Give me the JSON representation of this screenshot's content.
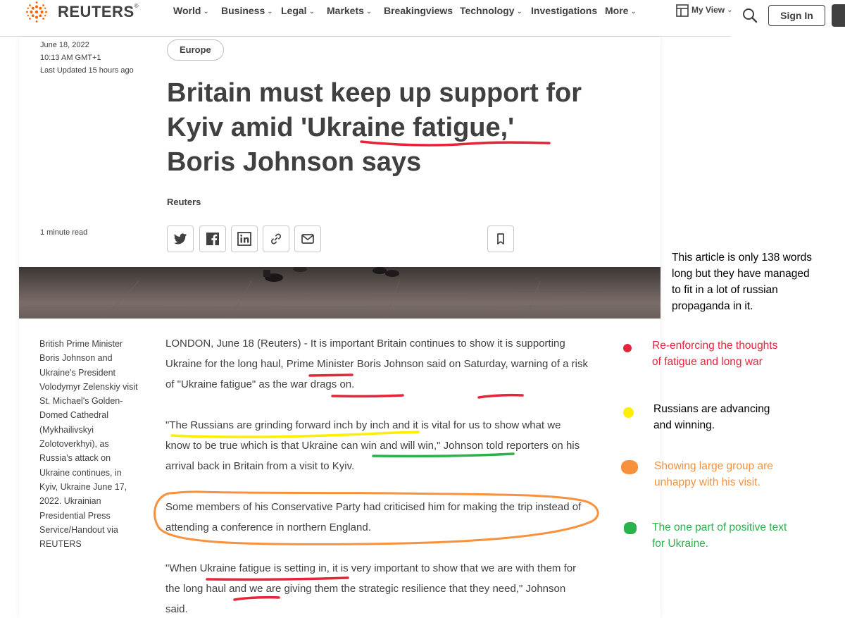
{
  "header": {
    "logo_text": "REUTERS",
    "logo_mark": "®",
    "nav_items": [
      {
        "label": "World",
        "has_dropdown": true
      },
      {
        "label": "Business",
        "has_dropdown": true
      },
      {
        "label": "Legal",
        "has_dropdown": true
      },
      {
        "label": "Markets",
        "has_dropdown": true
      },
      {
        "label": "Breakingviews",
        "has_dropdown": false
      },
      {
        "label": "Technology",
        "has_dropdown": true
      },
      {
        "label": "Investigations",
        "has_dropdown": false
      },
      {
        "label": "More",
        "has_dropdown": true
      }
    ],
    "my_view_label": "My View",
    "sign_in_label": "Sign In",
    "icons": {
      "my_view": "layout-icon",
      "search": "search-icon",
      "account": "account-icon"
    }
  },
  "article": {
    "date": "June 18, 2022",
    "time": "10:13 AM GMT+1",
    "last_updated": "Last Updated 15 hours ago",
    "section_tag": "Europe",
    "headline": "Britain must keep up support for Kyiv amid 'Ukraine fatigue,' Boris Johnson says",
    "byline": "Reuters",
    "read_time": "1 minute read",
    "share_icons": [
      "twitter-icon",
      "facebook-icon",
      "linkedin-icon",
      "link-icon",
      "email-icon"
    ],
    "bookmark_icon": "bookmark-icon",
    "photo_caption": "British Prime Minister Boris Johnson and Ukraine's President Volodymyr Zelenskiy visit St. Michael's Golden-Domed Cathedral (Mykhailivskyi Zolotoverkhyi), as Russia's attack on Ukraine continues, in Kyiv, Ukraine June 17, 2022. Ukrainian Presidential Press Service/Handout via REUTERS",
    "paragraphs": [
      "LONDON, June 18 (Reuters) - It is important Britain continues to show it is supporting Ukraine for the long haul, Prime Minister Boris Johnson said on Saturday, warning of a risk of \"Ukraine fatigue\" as the war drags on.",
      "\"The Russians are grinding forward inch by inch and it is vital for us to show what we know to be true which is that Ukraine can win and will win,\" Johnson told reporters on his arrival back in Britain from a visit to Kyiv.",
      "Some members of his Conservative Party had criticised him for making the trip instead of attending a conference in northern England.",
      "\"When Ukraine fatigue is setting in, it is very important to show that we are with them for the long haul and we are giving them the strategic resilience that they need,\" Johnson said."
    ]
  },
  "annotations": {
    "summary": "This article is only 138 words long but they have managed to fit in a lot of russian propaganda in it.",
    "legend": [
      {
        "color": "#e8243a",
        "text": "Re-enforcing the thoughts of fatigue and long war"
      },
      {
        "color": "#ffee00",
        "text": "Russians are advancing and winning."
      },
      {
        "color": "#f7913c",
        "text": "Showing large group are unhappy with his visit."
      },
      {
        "color": "#2ab34a",
        "text": "The one part of positive text for Ukraine."
      }
    ],
    "legend_text_colors": [
      "#e8243a",
      "#000000",
      "#f7913c",
      "#2ab34a"
    ]
  }
}
